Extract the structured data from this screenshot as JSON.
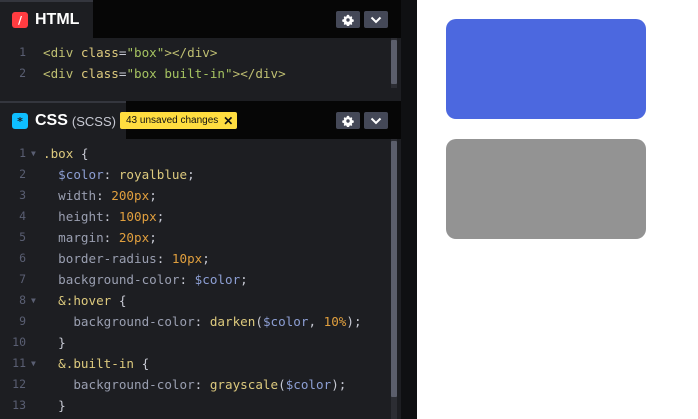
{
  "html_panel": {
    "title": "HTML",
    "lines": [
      {
        "num": "1",
        "tokens": [
          {
            "t": "<div ",
            "c": "tk-tag"
          },
          {
            "t": "class",
            "c": "tk-attr"
          },
          {
            "t": "=",
            "c": "tk-plain"
          },
          {
            "t": "\"box\"",
            "c": "tk-str"
          },
          {
            "t": "></div>",
            "c": "tk-tag"
          }
        ]
      },
      {
        "num": "2",
        "tokens": [
          {
            "t": "<div ",
            "c": "tk-tag"
          },
          {
            "t": "class",
            "c": "tk-attr"
          },
          {
            "t": "=",
            "c": "tk-plain"
          },
          {
            "t": "\"box built-in\"",
            "c": "tk-str"
          },
          {
            "t": ">",
            "c": "tk-tag"
          },
          {
            "t": "</div>",
            "c": "tk-tag"
          }
        ]
      }
    ]
  },
  "css_panel": {
    "title": "CSS",
    "subtitle": "(SCSS)",
    "unsaved_badge": "43 unsaved changes",
    "unsaved_close": "✕",
    "lines": [
      {
        "num": "1",
        "fold": true,
        "tokens": [
          {
            "t": ".box ",
            "c": "tk-sel"
          },
          {
            "t": "{",
            "c": "tk-plain"
          }
        ]
      },
      {
        "num": "2",
        "tokens": [
          {
            "t": "  ",
            "c": "tk-plain"
          },
          {
            "t": "$color",
            "c": "tk-var"
          },
          {
            "t": ": ",
            "c": "tk-plain"
          },
          {
            "t": "royalblue",
            "c": "tk-val"
          },
          {
            "t": ";",
            "c": "tk-plain"
          }
        ]
      },
      {
        "num": "3",
        "tokens": [
          {
            "t": "  ",
            "c": "tk-plain"
          },
          {
            "t": "width",
            "c": "tk-prop"
          },
          {
            "t": ": ",
            "c": "tk-plain"
          },
          {
            "t": "200px",
            "c": "tk-num"
          },
          {
            "t": ";",
            "c": "tk-plain"
          }
        ]
      },
      {
        "num": "4",
        "tokens": [
          {
            "t": "  ",
            "c": "tk-plain"
          },
          {
            "t": "height",
            "c": "tk-prop"
          },
          {
            "t": ": ",
            "c": "tk-plain"
          },
          {
            "t": "100px",
            "c": "tk-num"
          },
          {
            "t": ";",
            "c": "tk-plain"
          }
        ]
      },
      {
        "num": "5",
        "tokens": [
          {
            "t": "  ",
            "c": "tk-plain"
          },
          {
            "t": "margin",
            "c": "tk-prop"
          },
          {
            "t": ": ",
            "c": "tk-plain"
          },
          {
            "t": "20px",
            "c": "tk-num"
          },
          {
            "t": ";",
            "c": "tk-plain"
          }
        ]
      },
      {
        "num": "6",
        "tokens": [
          {
            "t": "  ",
            "c": "tk-plain"
          },
          {
            "t": "border-radius",
            "c": "tk-prop"
          },
          {
            "t": ": ",
            "c": "tk-plain"
          },
          {
            "t": "10px",
            "c": "tk-num"
          },
          {
            "t": ";",
            "c": "tk-plain"
          }
        ]
      },
      {
        "num": "7",
        "tokens": [
          {
            "t": "  ",
            "c": "tk-plain"
          },
          {
            "t": "background-color",
            "c": "tk-prop"
          },
          {
            "t": ": ",
            "c": "tk-plain"
          },
          {
            "t": "$color",
            "c": "tk-var"
          },
          {
            "t": ";",
            "c": "tk-plain"
          }
        ]
      },
      {
        "num": "8",
        "fold": true,
        "tokens": [
          {
            "t": "  ",
            "c": "tk-plain"
          },
          {
            "t": "&:hover ",
            "c": "tk-sel"
          },
          {
            "t": "{",
            "c": "tk-plain"
          }
        ]
      },
      {
        "num": "9",
        "tokens": [
          {
            "t": "    ",
            "c": "tk-plain"
          },
          {
            "t": "background-color",
            "c": "tk-prop"
          },
          {
            "t": ": ",
            "c": "tk-plain"
          },
          {
            "t": "darken",
            "c": "tk-fn"
          },
          {
            "t": "(",
            "c": "tk-plain"
          },
          {
            "t": "$color",
            "c": "tk-var"
          },
          {
            "t": ", ",
            "c": "tk-plain"
          },
          {
            "t": "10%",
            "c": "tk-num"
          },
          {
            "t": ");",
            "c": "tk-plain"
          }
        ]
      },
      {
        "num": "10",
        "tokens": [
          {
            "t": "  }",
            "c": "tk-plain"
          }
        ]
      },
      {
        "num": "11",
        "fold": true,
        "tokens": [
          {
            "t": "  ",
            "c": "tk-plain"
          },
          {
            "t": "&.built-in ",
            "c": "tk-sel"
          },
          {
            "t": "{",
            "c": "tk-plain"
          }
        ]
      },
      {
        "num": "12",
        "tokens": [
          {
            "t": "    ",
            "c": "tk-plain"
          },
          {
            "t": "background-color",
            "c": "tk-prop"
          },
          {
            "t": ": ",
            "c": "tk-plain"
          },
          {
            "t": "grayscale",
            "c": "tk-fn"
          },
          {
            "t": "(",
            "c": "tk-plain"
          },
          {
            "t": "$color",
            "c": "tk-var"
          },
          {
            "t": ");",
            "c": "tk-plain"
          }
        ]
      },
      {
        "num": "13",
        "tokens": [
          {
            "t": "  }",
            "c": "tk-plain"
          }
        ]
      }
    ]
  },
  "preview": {
    "boxes": [
      {
        "name": "box",
        "color": "#4c68df"
      },
      {
        "name": "box built-in",
        "color": "#939393"
      }
    ]
  },
  "icons": {
    "html": "html-icon",
    "css": "css-icon",
    "settings": "gear-icon",
    "collapse": "chevron-down-icon"
  },
  "colors": {
    "editor_bg": "#1d1e22",
    "header_bg": "#060606",
    "html_icon": "#ff3c41",
    "css_icon": "#0ebeff",
    "badge_bg": "#ffdd40"
  }
}
